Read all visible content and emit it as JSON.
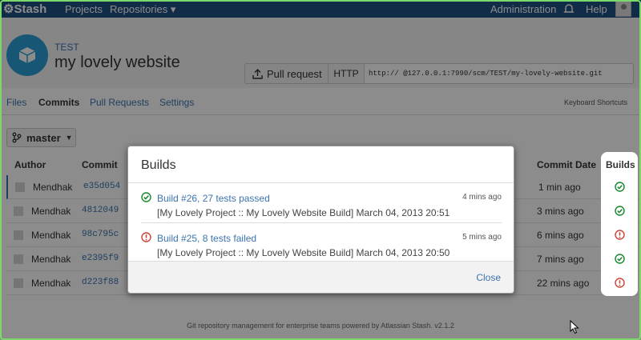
{
  "topbar": {
    "logo": "Stash",
    "projects": "Projects",
    "repositories": "Repositories ▾",
    "administration": "Administration",
    "help": "Help"
  },
  "repo": {
    "project": "TEST",
    "name": "my lovely website",
    "pull_request": "Pull request",
    "clone_protocol": "HTTP",
    "clone_url": "http://       @127.0.0.1:7990/scm/TEST/my-lovely-website.git"
  },
  "tabs": [
    {
      "label": "Files"
    },
    {
      "label": "Commits"
    },
    {
      "label": "Pull Requests"
    },
    {
      "label": "Settings"
    }
  ],
  "keyboard_shortcuts": "Keyboard Shortcuts",
  "branch": "master",
  "table": {
    "headers": {
      "author": "Author",
      "commit": "Commit",
      "date": "Commit Date",
      "builds": "Builds"
    },
    "rows": [
      {
        "author": "Mendhak",
        "hash": "e35d054",
        "date": "1 min ago",
        "status": "success"
      },
      {
        "author": "Mendhak",
        "hash": "4812049",
        "date": "3 mins ago",
        "status": "success"
      },
      {
        "author": "Mendhak",
        "hash": "98c795c",
        "date": "6 mins ago",
        "status": "failed"
      },
      {
        "author": "Mendhak",
        "hash": "e2395f9",
        "date": "7 mins ago",
        "status": "success"
      },
      {
        "author": "Mendhak",
        "hash": "d223f88",
        "date": "22 mins ago",
        "status": "failed"
      }
    ]
  },
  "modal": {
    "title": "Builds",
    "builds": [
      {
        "name": "Build #26, 27 tests passed",
        "detail": "[My Lovely Project :: My Lovely Website Build] March 04, 2013 20:51",
        "time": "4 mins ago",
        "status": "success"
      },
      {
        "name": "Build #25, 8 tests failed",
        "detail": "[My Lovely Project :: My Lovely Website Build] March 04, 2013 20:50",
        "time": "5 mins ago",
        "status": "failed"
      }
    ],
    "close": "Close"
  },
  "footer": {
    "text": "Git repository management for enterprise teams powered by Atlassian Stash. v2.1.2"
  },
  "colors": {
    "success": "#14892c",
    "failed": "#d04437",
    "link": "#3b73af",
    "topbar": "#205081"
  },
  "icons": {
    "success": "check-circle-icon",
    "failed": "exclamation-circle-icon",
    "cursor": "mouse-pointer-icon"
  }
}
